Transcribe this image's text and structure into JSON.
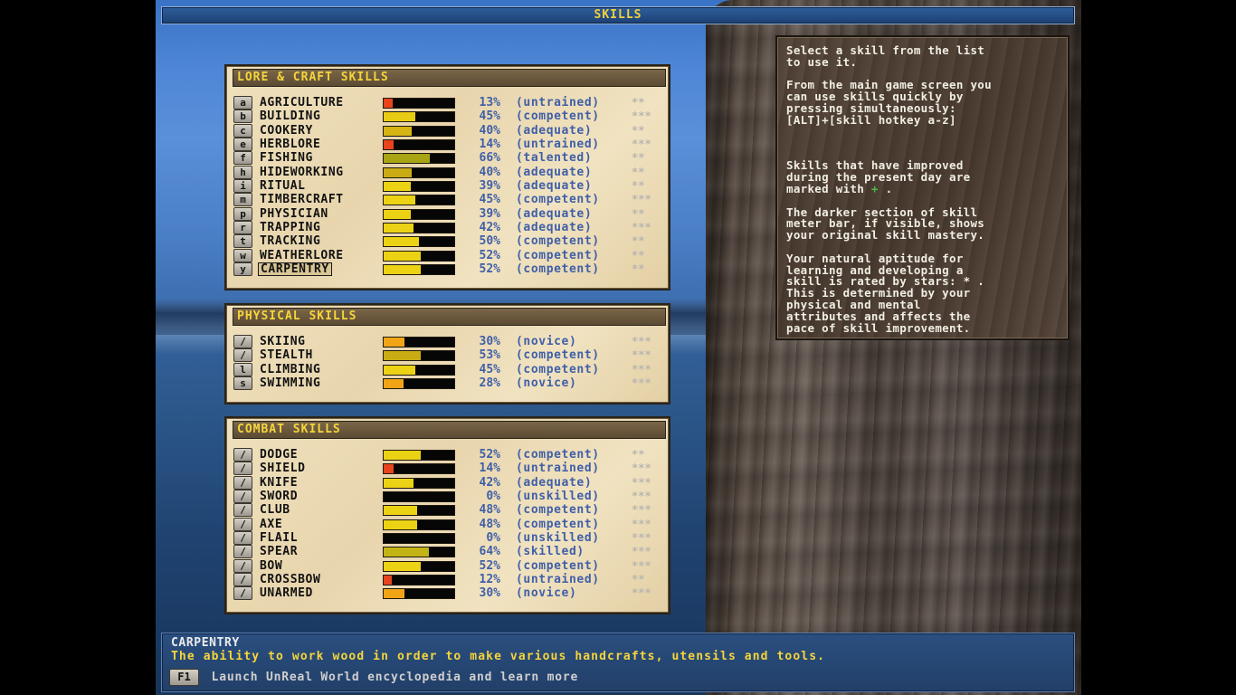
{
  "title": "SKILLS",
  "sections": [
    {
      "title": "LORE & CRAFT SKILLS",
      "rows": [
        {
          "key": "a",
          "name": "AGRICULTURE",
          "percent": "13%",
          "level": "(untrained)",
          "stars": "**",
          "value": 13,
          "color": "#e8431c"
        },
        {
          "key": "b",
          "name": "BUILDING",
          "percent": "45%",
          "level": "(competent)",
          "stars": "***",
          "value": 45,
          "color": "#e8cc14"
        },
        {
          "key": "c",
          "name": "COOKERY",
          "percent": "40%",
          "level": "(adequate)",
          "stars": "**",
          "value": 40,
          "color": "#d6b414"
        },
        {
          "key": "e",
          "name": "HERBLORE",
          "percent": "14%",
          "level": "(untrained)",
          "stars": "***",
          "value": 14,
          "color": "#e8431c"
        },
        {
          "key": "f",
          "name": "FISHING",
          "percent": "66%",
          "level": "(talented)",
          "stars": "**",
          "value": 66,
          "color": "#a8a414"
        },
        {
          "key": "h",
          "name": "HIDEWORKING",
          "percent": "40%",
          "level": "(adequate)",
          "stars": "**",
          "value": 40,
          "color": "#c9ac14"
        },
        {
          "key": "i",
          "name": "RITUAL",
          "percent": "39%",
          "level": "(adequate)",
          "stars": "**",
          "value": 39,
          "color": "#ecd214"
        },
        {
          "key": "m",
          "name": "TIMBERCRAFT",
          "percent": "45%",
          "level": "(competent)",
          "stars": "***",
          "value": 45,
          "color": "#ecd214"
        },
        {
          "key": "p",
          "name": "PHYSICIAN",
          "percent": "39%",
          "level": "(adequate)",
          "stars": "**",
          "value": 39,
          "color": "#ecd214"
        },
        {
          "key": "r",
          "name": "TRAPPING",
          "percent": "42%",
          "level": "(adequate)",
          "stars": "***",
          "value": 42,
          "color": "#ecd214"
        },
        {
          "key": "t",
          "name": "TRACKING",
          "percent": "50%",
          "level": "(competent)",
          "stars": "**",
          "value": 50,
          "color": "#ecd214"
        },
        {
          "key": "w",
          "name": "WEATHERLORE",
          "percent": "52%",
          "level": "(competent)",
          "stars": "**",
          "value": 52,
          "color": "#ecd214"
        },
        {
          "key": "y",
          "name": "CARPENTRY",
          "percent": "52%",
          "level": "(competent)",
          "stars": "**",
          "value": 52,
          "color": "#ecd214",
          "selected": true
        }
      ]
    },
    {
      "title": "PHYSICAL SKILLS",
      "rows": [
        {
          "key": "/",
          "name": "SKIING",
          "percent": "30%",
          "level": "(novice)",
          "stars": "***",
          "value": 30,
          "color": "#f0a416"
        },
        {
          "key": "/",
          "name": "STEALTH",
          "percent": "53%",
          "level": "(competent)",
          "stars": "***",
          "value": 53,
          "color": "#c9ac14"
        },
        {
          "key": "l",
          "name": "CLIMBING",
          "percent": "45%",
          "level": "(competent)",
          "stars": "***",
          "value": 45,
          "color": "#ecd214"
        },
        {
          "key": "s",
          "name": "SWIMMING",
          "percent": "28%",
          "level": "(novice)",
          "stars": "***",
          "value": 28,
          "color": "#f0a416"
        }
      ]
    },
    {
      "title": "COMBAT SKILLS",
      "rows": [
        {
          "key": "/",
          "name": "DODGE",
          "percent": "52%",
          "level": "(competent)",
          "stars": "**",
          "value": 52,
          "color": "#ecd214"
        },
        {
          "key": "/",
          "name": "SHIELD",
          "percent": "14%",
          "level": "(untrained)",
          "stars": "***",
          "value": 14,
          "color": "#e8431c"
        },
        {
          "key": "/",
          "name": "KNIFE",
          "percent": "42%",
          "level": "(adequate)",
          "stars": "***",
          "value": 42,
          "color": "#ecd214"
        },
        {
          "key": "/",
          "name": "SWORD",
          "percent": "0%",
          "level": "(unskilled)",
          "stars": "***",
          "value": 0,
          "color": "#ecd214"
        },
        {
          "key": "/",
          "name": "CLUB",
          "percent": "48%",
          "level": "(competent)",
          "stars": "***",
          "value": 48,
          "color": "#ecd214"
        },
        {
          "key": "/",
          "name": "AXE",
          "percent": "48%",
          "level": "(competent)",
          "stars": "***",
          "value": 48,
          "color": "#ecd214"
        },
        {
          "key": "/",
          "name": "FLAIL",
          "percent": "0%",
          "level": "(unskilled)",
          "stars": "***",
          "value": 0,
          "color": "#ecd214"
        },
        {
          "key": "/",
          "name": "SPEAR",
          "percent": "64%",
          "level": "(skilled)",
          "stars": "***",
          "value": 64,
          "color": "#c2b414"
        },
        {
          "key": "/",
          "name": "BOW",
          "percent": "52%",
          "level": "(competent)",
          "stars": "***",
          "value": 52,
          "color": "#ecd214"
        },
        {
          "key": "/",
          "name": "CROSSBOW",
          "percent": "12%",
          "level": "(untrained)",
          "stars": "**",
          "value": 12,
          "color": "#e8431c"
        },
        {
          "key": "/",
          "name": "UNARMED",
          "percent": "30%",
          "level": "(novice)",
          "stars": "***",
          "value": 30,
          "color": "#f0a416"
        }
      ]
    }
  ],
  "help": {
    "p1": "Select a skill from the list\nto use it.",
    "p2": "From the main game screen you\ncan use skills quickly by\npressing simultaneously:\n[ALT]+[skill hotkey a-z]",
    "p3_before": "Skills that have improved\nduring the present day are\nmarked with ",
    "p3_plus": "+",
    "p3_after": " .",
    "p4": "The darker section of skill\nmeter bar, if visible, shows\nyour original skill mastery.",
    "p5": "Your natural aptitude for\nlearning and developing a\nskill is rated by stars: * .\nThis is determined by your\nphysical and mental\nattributes and affects the\npace of skill improvement."
  },
  "info": {
    "name": "CARPENTRY",
    "description": "The ability to work wood in order to make various handcrafts, utensils and tools.",
    "f1_key": "F1",
    "f1_text": "Launch UnReal World encyclopedia and learn more"
  }
}
